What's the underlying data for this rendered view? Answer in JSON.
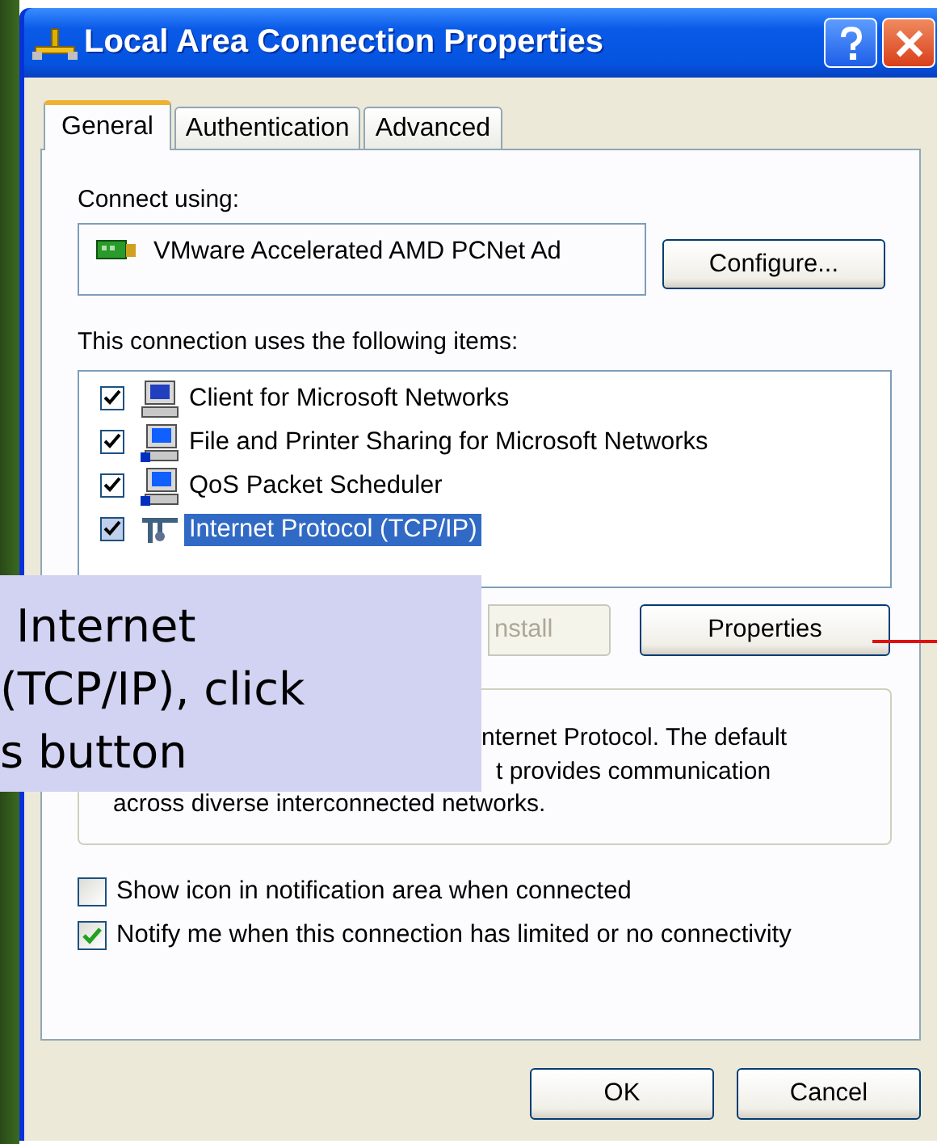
{
  "window": {
    "title": "Local Area Connection Properties"
  },
  "tabs": [
    {
      "label": "General",
      "selected": true
    },
    {
      "label": "Authentication",
      "selected": false
    },
    {
      "label": "Advanced",
      "selected": false
    }
  ],
  "connect_using": {
    "label": "Connect using:",
    "adapter": "VMware Accelerated AMD PCNet Ad",
    "button": "Configure..."
  },
  "items_label": "This connection uses the following items:",
  "items": [
    {
      "label": "Client for Microsoft Networks",
      "kind": "client",
      "checked": true,
      "selected": false
    },
    {
      "label": "File and Printer Sharing for Microsoft Networks",
      "kind": "service",
      "checked": true,
      "selected": false
    },
    {
      "label": "QoS Packet Scheduler",
      "kind": "service",
      "checked": true,
      "selected": false
    },
    {
      "label": "Internet Protocol (TCP/IP)",
      "kind": "protocol",
      "checked": true,
      "selected": true
    }
  ],
  "item_buttons": [
    {
      "label": "nstall",
      "disabled": true
    },
    {
      "label": "Properties",
      "disabled": false
    }
  ],
  "description": [
    "nternet Protocol. The default",
    "t provides communication",
    "across diverse interconnected networks."
  ],
  "options": [
    {
      "label": "Show icon in notification area when connected",
      "checked": false
    },
    {
      "label": "Notify me when this connection has limited or no connectivity",
      "checked": true
    }
  ],
  "dialog_buttons": [
    "OK",
    "Cancel"
  ],
  "callout": {
    "lines": [
      "Internet",
      "(TCP/IP), click",
      "s button"
    ]
  }
}
